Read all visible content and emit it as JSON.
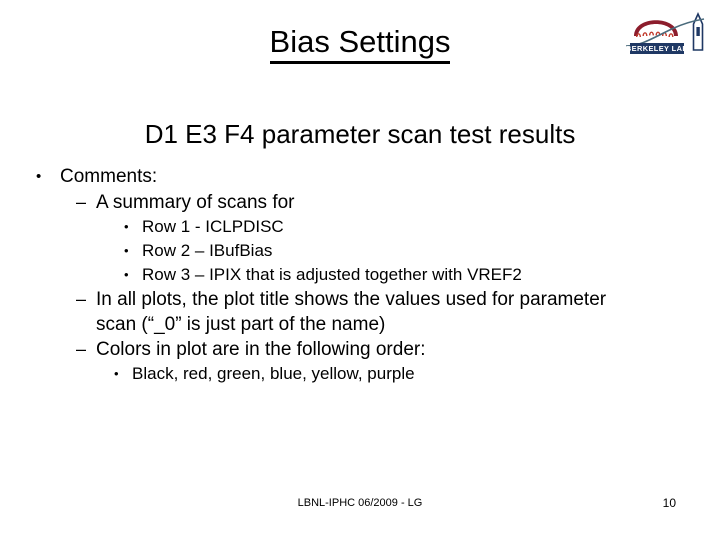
{
  "slide": {
    "title": "Bias Settings",
    "subtitle": "D1 E3 F4 parameter scan test results",
    "bullets": {
      "comments_label": "Comments:",
      "summary_label": "A summary of scans for",
      "row1": "Row 1 - ICLPDISC",
      "row2": "Row 2 – IBufBias",
      "row3": "Row 3 – IPIX that is adjusted together with VREF2",
      "plots_line1": "In all plots, the plot title shows the values used for parameter",
      "plots_line2": "scan (“_0” is just part of the name)",
      "colors_label": "Colors in plot are in the following order:",
      "colors_list": "Black, red, green, blue, yellow, purple"
    },
    "marks": {
      "disc": "•",
      "dash": "–"
    }
  },
  "footer": {
    "center": "LBNL-IPHC 06/2009 - LG",
    "page_number": "10"
  },
  "logo": {
    "wordmark": "BERKELEY LAB",
    "arch_color": "#8c1d2c",
    "column_color": "#c0392b",
    "tower_color": "#1f3864",
    "banner_color": "#1f3864",
    "swoosh_color": "#4a6b7c"
  }
}
